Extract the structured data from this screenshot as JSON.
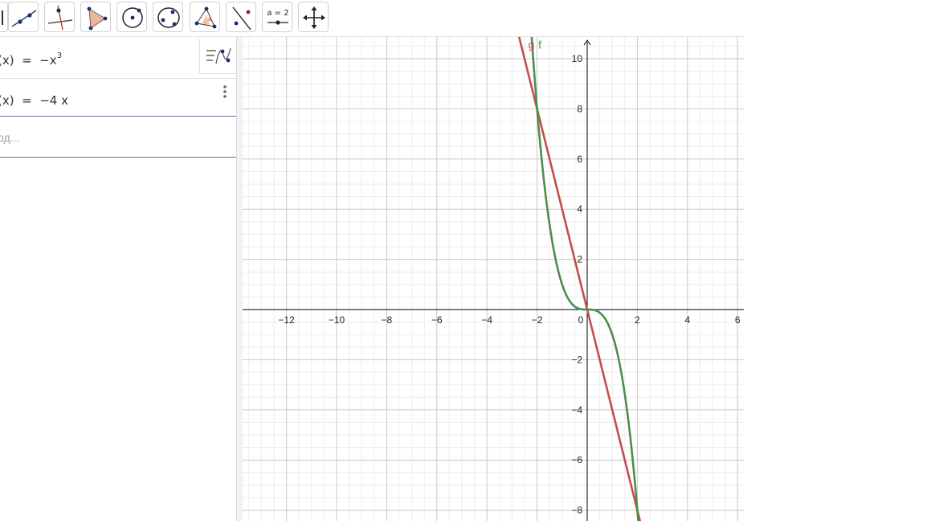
{
  "toolbar": {
    "tools": [
      {
        "name": "move-tool",
        "icon": "move-arrow-icon"
      },
      {
        "name": "line-tool",
        "icon": "line-through-two-points-icon"
      },
      {
        "name": "perpendicular-line-tool",
        "icon": "perpendicular-line-icon"
      },
      {
        "name": "polygon-tool",
        "icon": "polygon-icon"
      },
      {
        "name": "circle-center-point-tool",
        "icon": "circle-center-point-icon"
      },
      {
        "name": "circle-three-points-tool",
        "icon": "circle-three-points-icon"
      },
      {
        "name": "angle-tool",
        "icon": "angle-icon"
      },
      {
        "name": "reflect-tool",
        "icon": "reflect-about-line-icon"
      },
      {
        "name": "slider-tool",
        "icon": "slider-icon",
        "label": "a = 2"
      },
      {
        "name": "move-graphics-view-tool",
        "icon": "move-view-icon"
      }
    ]
  },
  "algebra": {
    "rows": [
      {
        "prefix": "(x)  =  ",
        "expression": "−x",
        "exponent": "3"
      },
      {
        "prefix": "(x)  =  ",
        "expression": "−4 x"
      }
    ],
    "input_placeholder": "од..."
  },
  "graph": {
    "x_ticks": [
      "−12",
      "−10",
      "−8",
      "−6",
      "−4",
      "−2",
      "0",
      "2",
      "4",
      "6"
    ],
    "x_tick_values": [
      -12,
      -10,
      -8,
      -6,
      -4,
      -2,
      0,
      2,
      4,
      6
    ],
    "y_ticks": [
      "−8",
      "−6",
      "−4",
      "−2",
      "2",
      "4",
      "6",
      "8",
      "10"
    ],
    "y_tick_values": [
      -8,
      -6,
      -4,
      -2,
      2,
      4,
      6,
      8,
      10
    ],
    "curve_labels": {
      "g": "g",
      "f": "f"
    },
    "colors": {
      "f": "#4e8d4e",
      "g": "#c0504d",
      "axes": "#000000",
      "grid_major": "#c8c8c8",
      "grid_minor": "#ececec"
    },
    "functions": {
      "f": "-x^3",
      "g": "-4x"
    }
  }
}
